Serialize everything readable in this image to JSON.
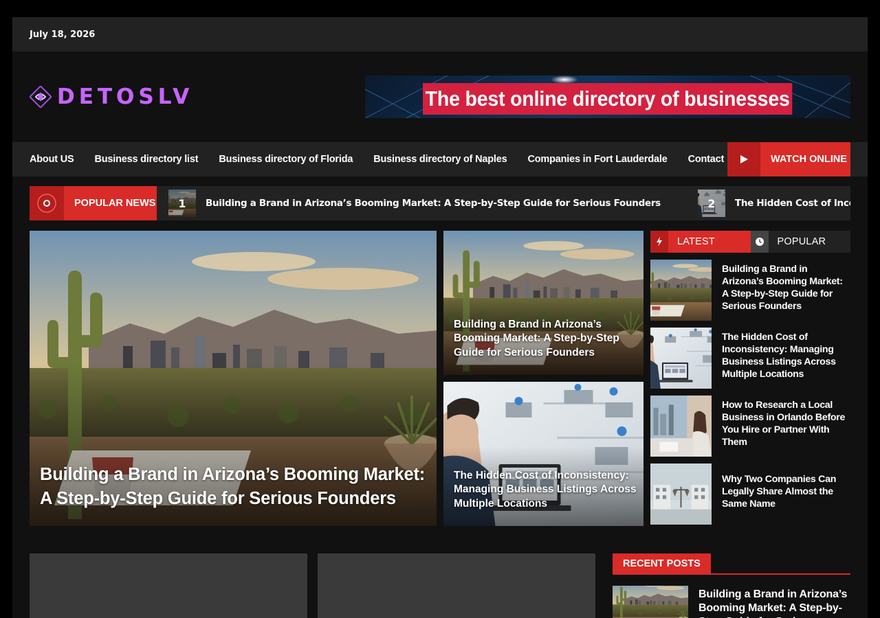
{
  "topbar": {
    "date": "July 18, 2026"
  },
  "header": {
    "logo_text": "DETOSLV",
    "banner_text": "The best online directory of businesses"
  },
  "nav": {
    "items": [
      "About US",
      "Business directory list",
      "Business directory of Florida",
      "Business directory of Naples",
      "Companies in Fort Lauderdale",
      "Contact"
    ],
    "watch_label": "WATCH ONLINE"
  },
  "ticker": {
    "label": "POPULAR NEWS",
    "items": [
      {
        "num": "1",
        "title": "Building a Brand in Arizona’s Booming Market: A Step-by-Step Guide for Serious Founders"
      },
      {
        "num": "2",
        "title": "The Hidden Cost of Inconsistency: Managing Business Listings Across Multiple Locations"
      }
    ]
  },
  "featured": {
    "main_title": "Building a Brand in Arizona’s Booming Market: A Step-by-Step Guide for Serious Founders",
    "side": [
      {
        "title": "Building a Brand in Arizona’s Booming Market: A Step-by-Step Guide for Serious Founders"
      },
      {
        "title": "The Hidden Cost of Inconsistency: Managing Business Listings Across Multiple Locations"
      }
    ]
  },
  "tabs_widget": {
    "latest_label": "LATEST",
    "popular_label": "POPULAR",
    "items": [
      {
        "title": "Building a Brand in Arizona’s Booming Market: A Step-by-Step Guide for Serious Founders"
      },
      {
        "title": "The Hidden Cost of Inconsistency: Managing Business Listings Across Multiple Locations"
      },
      {
        "title": "How to Research a Local Business in Orlando Before You Hire or Partner With Them"
      },
      {
        "title": "Why Two Companies Can Legally Share Almost the Same Name"
      }
    ]
  },
  "recent_posts": {
    "label": "RECENT POSTS",
    "items": [
      {
        "title": "Building a Brand in Arizona’s Booming Market: A Step-by-Step Guide for Serious Founders"
      }
    ]
  },
  "colors": {
    "accent": "#d92b28",
    "accent_dark": "#b51e1c",
    "bg": "#111111",
    "bar": "#222222",
    "logo": "#c764ff"
  }
}
